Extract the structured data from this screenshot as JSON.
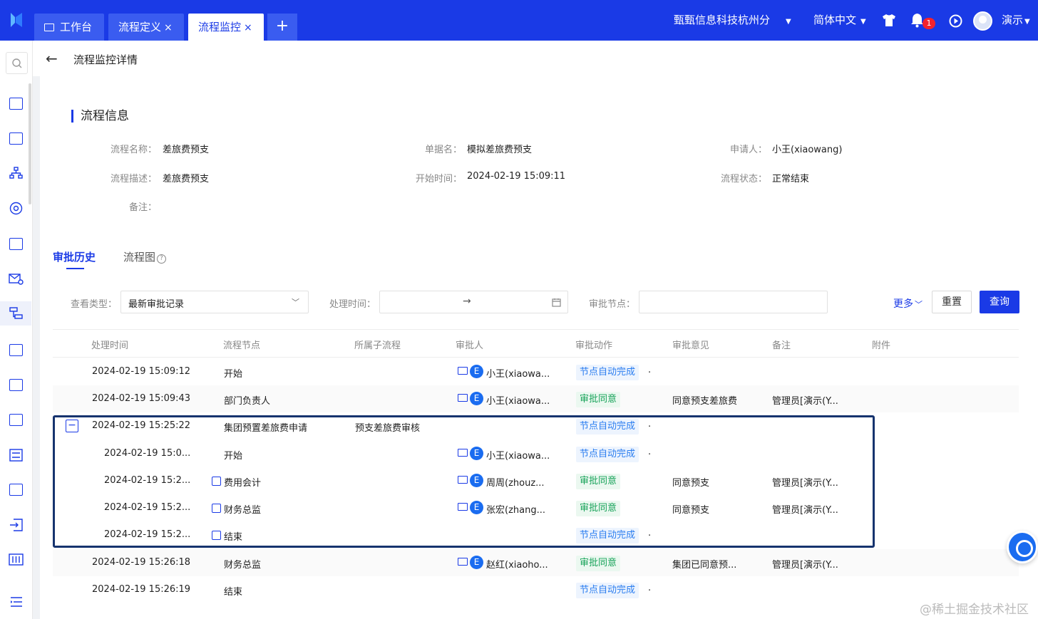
{
  "topbar": {
    "tabs": [
      {
        "label": "工作台"
      },
      {
        "label": "流程定义",
        "close": "×"
      },
      {
        "label": "流程监控",
        "close": "×"
      }
    ],
    "add_tab": "+",
    "company": "甄甄信息科技杭州分",
    "language": "简体中文",
    "notification_count": "1",
    "user": "演示"
  },
  "page": {
    "title": "流程监控详情"
  },
  "info": {
    "section_title": "流程信息",
    "fields": [
      {
        "label": "流程名称：",
        "value": "差旅费预支"
      },
      {
        "label": "单据名：",
        "value": "模拟差旅费预支"
      },
      {
        "label": "申请人：",
        "value": "小王(xiaowang)"
      },
      {
        "label": "流程描述：",
        "value": "差旅费预支"
      },
      {
        "label": "开始时间：",
        "value": "2024-02-19 15:09:11"
      },
      {
        "label": "流程状态：",
        "value": "正常结束"
      },
      {
        "label": "备注：",
        "value": ""
      }
    ]
  },
  "tabs2": {
    "history": "审批历史",
    "diagram": "流程图",
    "help": "?"
  },
  "filters": {
    "view_type_label": "查看类型：",
    "view_type_value": "最新审批记录",
    "time_label": "处理时间：",
    "time_arrow": "→",
    "node_label": "审批节点：",
    "more": "更多",
    "reset": "重置",
    "query": "查询"
  },
  "table": {
    "headers": [
      "处理时间",
      "流程节点",
      "所属子流程",
      "审批人",
      "审批动作",
      "审批意见",
      "备注",
      "附件"
    ],
    "rows": [
      {
        "time": "2024-02-19 15:09:12",
        "node": "开始",
        "sub": "",
        "approver": "小王(xiaowa...",
        "action": "节点自动完成",
        "kind": "auto",
        "dot": ".",
        "opinion": "",
        "remark": ""
      },
      {
        "time": "2024-02-19 15:09:43",
        "node": "部门负责人",
        "sub": "",
        "approver": "小王(xiaowa...",
        "action": "审批同意",
        "kind": "ok",
        "dot": "",
        "opinion": "同意预支差旅费",
        "remark": "管理员[演示(Y..."
      },
      {
        "time": "2024-02-19 15:25:22",
        "node": "集团预置差旅费申请",
        "sub": "预支差旅费审核",
        "approver": "",
        "action": "节点自动完成",
        "kind": "auto",
        "dot": ".",
        "opinion": "",
        "remark": ""
      },
      {
        "time": "2024-02-19 15:0...",
        "node": "开始",
        "sub": "",
        "approver": "小王(xiaowa...",
        "action": "节点自动完成",
        "kind": "auto",
        "dot": ".",
        "opinion": "",
        "remark": ""
      },
      {
        "time": "2024-02-19 15:2...",
        "node": "费用会计",
        "sub": "",
        "approver": "周周(zhouz...",
        "action": "审批同意",
        "kind": "ok",
        "dot": "",
        "opinion": "同意预支",
        "remark": "管理员[演示(Y..."
      },
      {
        "time": "2024-02-19 15:2...",
        "node": "财务总监",
        "sub": "",
        "approver": "张宏(zhang...",
        "action": "审批同意",
        "kind": "ok",
        "dot": "",
        "opinion": "同意预支",
        "remark": "管理员[演示(Y..."
      },
      {
        "time": "2024-02-19 15:2...",
        "node": "结束",
        "sub": "",
        "approver": "",
        "action": "节点自动完成",
        "kind": "auto",
        "dot": ".",
        "opinion": "",
        "remark": ""
      },
      {
        "time": "2024-02-19 15:26:18",
        "node": "财务总监",
        "sub": "",
        "approver": "赵红(xiaoho...",
        "action": "审批同意",
        "kind": "ok",
        "dot": "",
        "opinion": "集团已同意预...",
        "remark": "管理员[演示(Y..."
      },
      {
        "time": "2024-02-19 15:26:19",
        "node": "结束",
        "sub": "",
        "approver": "",
        "action": "节点自动完成",
        "kind": "auto",
        "dot": ".",
        "opinion": "",
        "remark": ""
      }
    ],
    "collapse_symbol": "−",
    "e_label": "E"
  },
  "watermark": "@稀土掘金技术社区",
  "colors": {
    "primary": "#1a3ae6",
    "auto_tag": "#2a7df0",
    "ok_tag": "#19a35a",
    "frame": "#16336e"
  }
}
